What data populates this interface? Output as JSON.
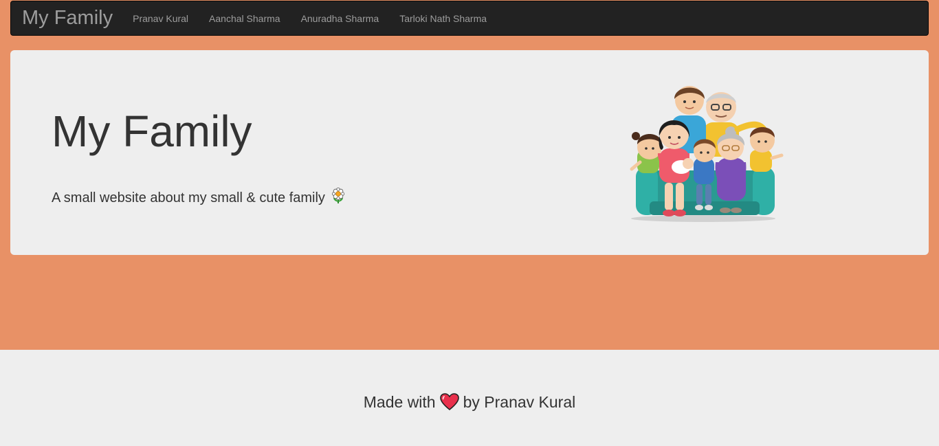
{
  "navbar": {
    "brand": "My Family",
    "links": [
      {
        "label": "Pranav Kural"
      },
      {
        "label": "Aanchal Sharma"
      },
      {
        "label": "Anuradha Sharma"
      },
      {
        "label": "Tarloki Nath Sharma"
      }
    ]
  },
  "hero": {
    "title": "My Family",
    "subtitle": "A small website about my small & cute family",
    "subtitle_icon": "flower-icon",
    "image": "family-illustration"
  },
  "footer": {
    "prefix": "Made with",
    "icon": "heart-icon",
    "suffix": "by Pranav Kural"
  },
  "colors": {
    "page_background": "#e89166",
    "navbar_background": "#222222",
    "navbar_text": "#9d9d9d",
    "panel_background": "#eeeeee",
    "text": "#333333",
    "heart": "#e8304c"
  }
}
